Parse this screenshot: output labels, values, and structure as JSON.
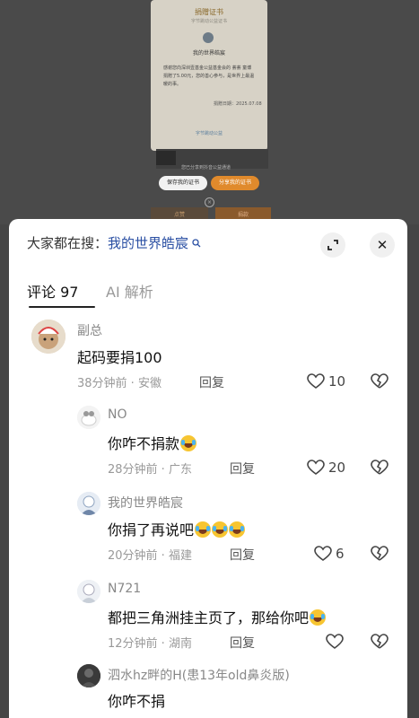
{
  "background": {
    "certificate_title": "捐赠证书",
    "certificate_subtitle": "字节跳动公益证书",
    "certificate_name": "我的世界皓宸",
    "certificate_body": "感谢您向深圳壹基金公益基金会的 荟荟 童博 捐赠了5.00元，您的善心参与，是世界上最温暖的事。",
    "certificate_date": "捐赠日期：2025.07.08",
    "certificate_footer": "字节跳动公益",
    "note": "您已分享到抖音公益通道",
    "save_button": "保存我的证书",
    "share_button": "分享我的证书",
    "tab_left": "点赞",
    "tab_right": "捐款"
  },
  "header": {
    "search_prefix": "大家都在搜：",
    "search_keyword": "我的世界皓宸",
    "search_icon": "magnifier-icon",
    "expand_icon": "expand-icon",
    "close_icon": "close-icon",
    "close_glyph": "✕"
  },
  "tabs": {
    "comments": "评论 97",
    "ai": "AI 解析"
  },
  "comments": [
    {
      "user": "副总",
      "text": "起码要捐100",
      "time": "38分钟前",
      "location": "安徽",
      "reply": "回复",
      "likes": "10"
    },
    {
      "user": "NO",
      "text": "你咋不捐款",
      "time": "28分钟前",
      "location": "广东",
      "reply": "回复",
      "likes": "20",
      "emojis": 1
    },
    {
      "user": "我的世界皓宸",
      "text": "你捐了再说吧",
      "time": "20分钟前",
      "location": "福建",
      "reply": "回复",
      "likes": "6",
      "emojis": 3
    },
    {
      "user": "N721",
      "text": "都把三角洲挂主页了，那给你吧",
      "time": "12分钟前",
      "location": "湖南",
      "reply": "回复",
      "likes": "",
      "emojis": 1
    },
    {
      "user": "泗水hz畔的H(患13年old鼻炎版)",
      "text": "你咋不捐"
    }
  ],
  "colors": {
    "keyword": "#2a4fa3",
    "backdrop": "#454545",
    "share_orange": "#e08a2c"
  }
}
